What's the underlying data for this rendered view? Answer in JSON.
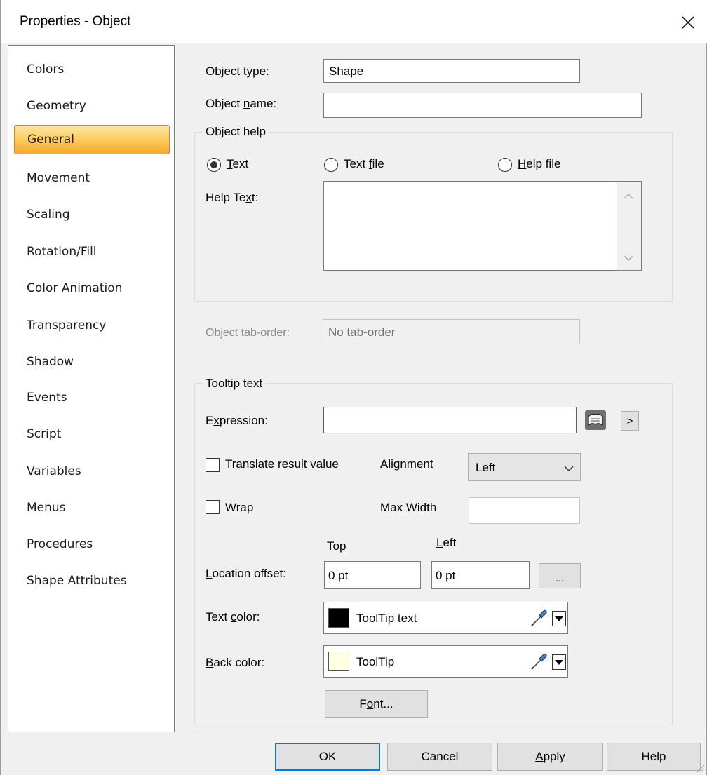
{
  "window": {
    "title": "Properties - Object",
    "close_glyph": "×"
  },
  "sidebar": {
    "items": [
      {
        "label": "Colors"
      },
      {
        "label": "Geometry"
      },
      {
        "label": "General",
        "selected": true
      },
      {
        "label": "Movement"
      },
      {
        "label": "Scaling"
      },
      {
        "label": "Rotation/Fill"
      },
      {
        "label": "Color Animation"
      },
      {
        "label": "Transparency"
      },
      {
        "label": "Shadow"
      },
      {
        "label": "Events"
      },
      {
        "label": "Script"
      },
      {
        "label": "Variables"
      },
      {
        "label": "Menus"
      },
      {
        "label": "Procedures"
      },
      {
        "label": "Shape Attributes"
      }
    ]
  },
  "general": {
    "object_type_label_a": "Object ty",
    "object_type_label_u": "p",
    "object_type_label_b": "e:",
    "object_type_value": "Shape",
    "object_name_label_a": "Object ",
    "object_name_label_u": "n",
    "object_name_label_b": "ame:",
    "object_name_value": "",
    "object_help": {
      "title": "Object help",
      "radio_text_u": "T",
      "radio_text_b": "ext",
      "radio_text_selected": true,
      "radio_textfile_a": "Text ",
      "radio_textfile_u": "f",
      "radio_textfile_b": "ile",
      "radio_helpfile_u": "H",
      "radio_helpfile_b": "elp file",
      "help_text_label_a": "Help Te",
      "help_text_label_u": "x",
      "help_text_label_b": "t:",
      "help_text_value": "",
      "scroll_up_glyph": "^",
      "scroll_down_glyph": "v"
    },
    "tab_order_label_a": "Object tab-",
    "tab_order_label_u": "o",
    "tab_order_label_b": "rder:",
    "tab_order_value": "No tab-order"
  },
  "tooltip": {
    "title": "Tooltip text",
    "expression_label_a": "E",
    "expression_label_u": "x",
    "expression_label_b": "pression:",
    "expression_value": "",
    "expression_more_glyph": ">",
    "translate_label_a": "Translate result ",
    "translate_label_u": "v",
    "translate_label_b": "alue",
    "translate_checked": false,
    "alignment_label": "Alignment",
    "alignment_value": "Left",
    "wrap_label": "Wrap",
    "wrap_checked": false,
    "max_width_label": "Max Width",
    "max_width_value": "",
    "top_label_a": "To",
    "top_label_u": "p",
    "left_label_u": "L",
    "left_label_b": "eft",
    "location_label_a": "",
    "location_label_u": "L",
    "location_label_b": "ocation offset:",
    "top_value": "0 pt",
    "left_value": "0 pt",
    "ellipsis_glyph": "...",
    "text_color_label_a": "Text ",
    "text_color_label_u": "c",
    "text_color_label_b": "olor:",
    "text_color_name": "ToolTip text",
    "text_color_swatch": "#000000",
    "back_color_label_u": "B",
    "back_color_label_b": "ack color:",
    "back_color_name": "ToolTip",
    "back_color_swatch": "#ffffe1",
    "font_button_a": "F",
    "font_button_u": "o",
    "font_button_b": "nt..."
  },
  "footer": {
    "ok": "OK",
    "cancel": "Cancel",
    "apply_u": "A",
    "apply_b": "pply",
    "help": "Help"
  }
}
